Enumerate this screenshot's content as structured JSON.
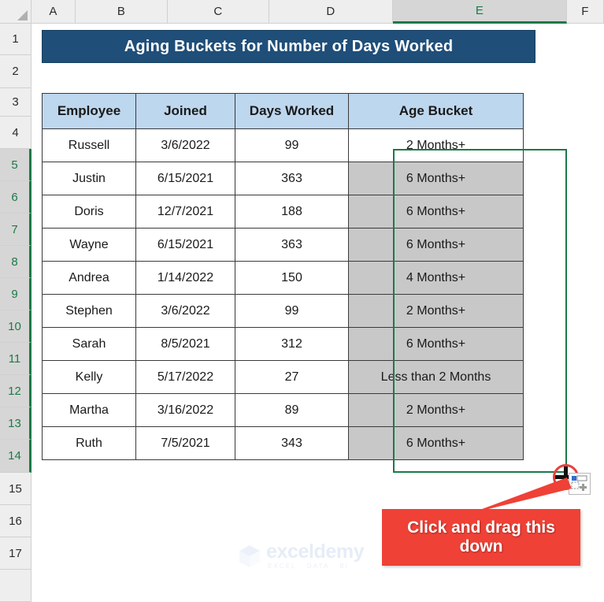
{
  "app": {
    "type": "spreadsheet",
    "accent_selection_green": "#1b7a47",
    "title_banner_color": "#1f4e79",
    "header_row_color": "#bdd7ee",
    "selected_cell_color": "#c8c8c8",
    "callout_color": "#ef4136"
  },
  "grid": {
    "column_headers": [
      "A",
      "B",
      "C",
      "D",
      "E",
      "F"
    ],
    "selected_column": "E",
    "row_headers": [
      "1",
      "2",
      "3",
      "4",
      "5",
      "6",
      "7",
      "8",
      "9",
      "10",
      "11",
      "12",
      "13",
      "14",
      "15",
      "16",
      "17"
    ],
    "selected_rows": [
      "5",
      "6",
      "7",
      "8",
      "9",
      "10",
      "11",
      "12",
      "13",
      "14"
    ]
  },
  "title": {
    "text": "Aging Buckets for Number of Days Worked"
  },
  "table": {
    "columns": [
      "Employee",
      "Joined",
      "Days Worked",
      "Age Bucket"
    ],
    "rows": [
      {
        "employee": "Russell",
        "joined": "3/6/2022",
        "days_worked": "99",
        "age_bucket": "2 Months+",
        "bucket_selected": false
      },
      {
        "employee": "Justin",
        "joined": "6/15/2021",
        "days_worked": "363",
        "age_bucket": "6 Months+",
        "bucket_selected": true
      },
      {
        "employee": "Doris",
        "joined": "12/7/2021",
        "days_worked": "188",
        "age_bucket": "6 Months+",
        "bucket_selected": true
      },
      {
        "employee": "Wayne",
        "joined": "6/15/2021",
        "days_worked": "363",
        "age_bucket": "6 Months+",
        "bucket_selected": true
      },
      {
        "employee": "Andrea",
        "joined": "1/14/2022",
        "days_worked": "150",
        "age_bucket": "4 Months+",
        "bucket_selected": true
      },
      {
        "employee": "Stephen",
        "joined": "3/6/2022",
        "days_worked": "99",
        "age_bucket": "2 Months+",
        "bucket_selected": true
      },
      {
        "employee": "Sarah",
        "joined": "8/5/2021",
        "days_worked": "312",
        "age_bucket": "6 Months+",
        "bucket_selected": true
      },
      {
        "employee": "Kelly",
        "joined": "5/17/2022",
        "days_worked": "27",
        "age_bucket": "Less than 2 Months",
        "bucket_selected": true
      },
      {
        "employee": "Martha",
        "joined": "3/16/2022",
        "days_worked": "89",
        "age_bucket": "2 Months+",
        "bucket_selected": true
      },
      {
        "employee": "Ruth",
        "joined": "7/5/2021",
        "days_worked": "343",
        "age_bucket": "6 Months+",
        "bucket_selected": true
      }
    ]
  },
  "annotation": {
    "callout_text": "Click and drag this down"
  },
  "watermark": {
    "name": "exceldemy",
    "tagline": "EXCEL · DATA · BI"
  }
}
